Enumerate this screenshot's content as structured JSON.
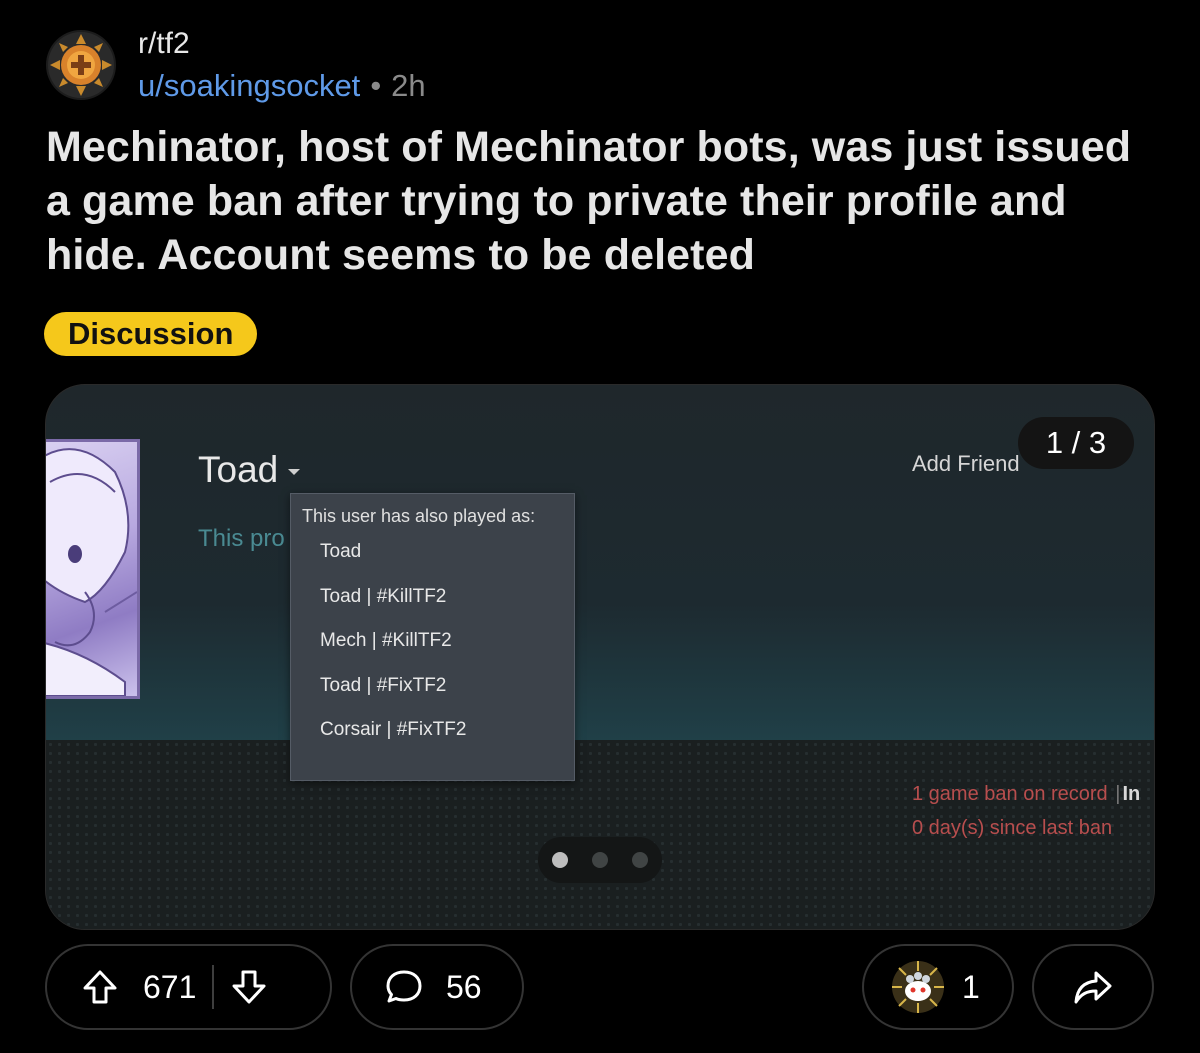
{
  "post": {
    "subreddit": "r/tf2",
    "author": "u/soakingsocket",
    "separator": "•",
    "age": "2h",
    "title": "Mechinator, host of Mechinator bots, was just issued a game ban after trying to private their profile and hide. Account seems to be deleted",
    "flair": "Discussion",
    "flair_color": "#f5c81b"
  },
  "media": {
    "counter": "1 / 3",
    "current_index": 1,
    "total": 3,
    "profile_name": "Toad",
    "private_text": "This pro",
    "add_friend": "Add Friend",
    "more": "...",
    "dropdown_header": "This user has also played as:",
    "aliases": [
      "Toad",
      "Toad | #KillTF2",
      "Mech | #KillTF2",
      "Toad | #FixTF2",
      "Corsair | #FixTF2"
    ],
    "ban_line1": "1 game ban on record",
    "ban_sep": "|",
    "ban_info": "In",
    "ban_line2": "0 day(s) since last ban",
    "ban_color": "#b84e4e"
  },
  "actions": {
    "upvotes": "671",
    "comments": "56",
    "awards": "1"
  },
  "colors": {
    "link": "#5f9ae8",
    "background": "#000000"
  }
}
